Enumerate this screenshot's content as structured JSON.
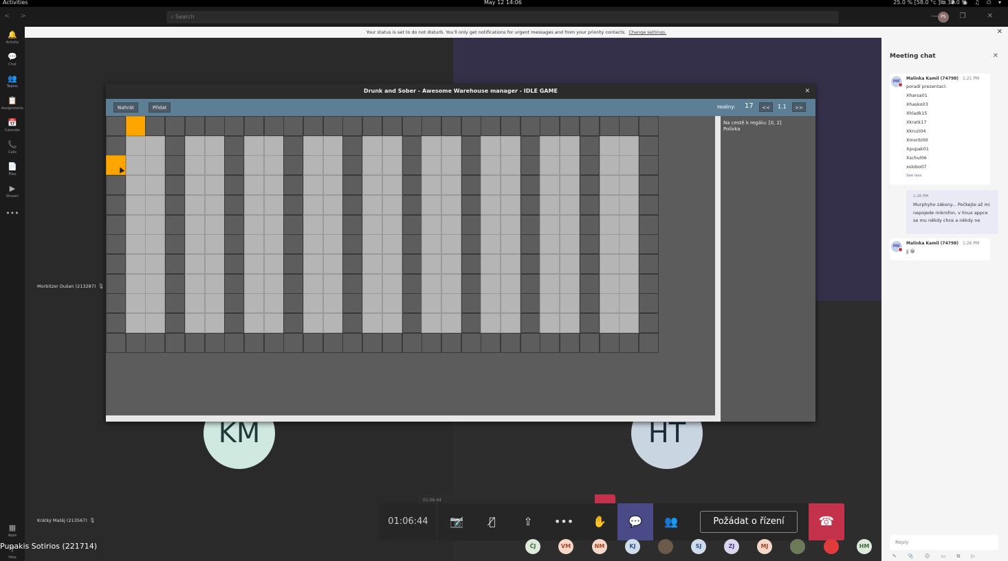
{
  "topbar": {
    "activities": "Activities",
    "clock": "May 12  14:06",
    "stats": "25.0 % [58.0 °c ] ⧉ 32.0 %",
    "sysicons": "⇪ ✱ ◉ ♫ ⏻ ▾"
  },
  "titlebar": {
    "search_placeholder": "Search",
    "me_initials": "PS"
  },
  "rail": [
    {
      "icon": "bell-icon",
      "glyph": "🔔",
      "label": "Activity"
    },
    {
      "icon": "chat-icon",
      "glyph": "💬",
      "label": "Chat"
    },
    {
      "icon": "teams-icon",
      "glyph": "👥",
      "label": "Teams"
    },
    {
      "icon": "assignments-icon",
      "glyph": "📋",
      "label": "Assignments"
    },
    {
      "icon": "calendar-icon",
      "glyph": "📅",
      "label": "Calendar"
    },
    {
      "icon": "calls-icon",
      "glyph": "📞",
      "label": "Calls"
    },
    {
      "icon": "files-icon",
      "glyph": "📄",
      "label": "Files"
    },
    {
      "icon": "stream-icon",
      "glyph": "▶",
      "label": "Stream"
    },
    {
      "icon": "more-icon",
      "glyph": "•••",
      "label": ""
    },
    {
      "icon": "apps-icon",
      "glyph": "▦",
      "label": "Apps"
    },
    {
      "icon": "help-icon",
      "glyph": "?",
      "label": "Help"
    }
  ],
  "banner": {
    "text": "Your status is set to do not disturb. You'll only get notifications for urgent messages and from your priority contacts.",
    "link": "Change settings."
  },
  "participants": {
    "top_left_name": "Morbitzer Dušan (213287)",
    "bottom_left_name": "Krátký Matěj (213567)",
    "km": "KM",
    "ht": "HT",
    "self": "Pupakis Sotirios (221714)"
  },
  "controls": {
    "timer": "01:06:44",
    "ghost_timer": "01:06:44",
    "request_control": "Požádat o řízení"
  },
  "avatars": [
    {
      "initials": "ČJ",
      "bg": "#dfe9dc",
      "fg": "#3c6a3a"
    },
    {
      "initials": "VM",
      "bg": "#f6d7c8",
      "fg": "#a3472a"
    },
    {
      "initials": "NM",
      "bg": "#f6d7c8",
      "fg": "#a3472a"
    },
    {
      "initials": "KJ",
      "bg": "#cfdcec",
      "fg": "#2e5385"
    },
    {
      "initials": "",
      "bg": "#6b5a4a",
      "fg": "#ffffff"
    },
    {
      "initials": "SJ",
      "bg": "#cfdcec",
      "fg": "#2e5385"
    },
    {
      "initials": "ZJ",
      "bg": "#dcd7ef",
      "fg": "#4c3f8c"
    },
    {
      "initials": "MJ",
      "bg": "#f6d7c8",
      "fg": "#a3472a"
    },
    {
      "initials": "",
      "bg": "#6d7a5a",
      "fg": "#ffffff"
    },
    {
      "initials": "",
      "bg": "#e23b3b",
      "fg": "#ffffff"
    },
    {
      "initials": "HM",
      "bg": "#dfe9dc",
      "fg": "#3c6a3a"
    }
  ],
  "chat": {
    "title": "Meeting chat",
    "msg1": {
      "initials": "MK",
      "author": "Malinka Kamil (74798)",
      "time": "1:21 PM",
      "lines": [
        "poradí prezentací:",
        "Xharsa01",
        "Xhasko03",
        "Xhladk15",
        "Xkratk17",
        "Xkruzi04",
        "Xmorbi00",
        "Xpupak01",
        "Xschul06",
        "xslobo07"
      ],
      "see_less": "See less"
    },
    "mine": {
      "time": "1:26 PM",
      "text": "Murphyho zákony... Počkejte až mi nepojede mikrofon, v linux appce se mu někdy chce a někdy ne"
    },
    "msg2": {
      "initials": "MK",
      "author": "Malinka Kamil (74798)",
      "time": "1:26 PM",
      "text": "jj 😀"
    },
    "reply_placeholder": "Reply",
    "reply_tools": "✎ 📎 ☺ ▭ ⧉ ▷ ··· ➤"
  },
  "game": {
    "title": "Drunk and Sober - Awesome Warehouse manager - IDLE GAME",
    "btn_load": "Nahrát",
    "btn_add": "Přidat",
    "hours_label": "Hodiny:",
    "hours_value": "17",
    "prev": "<<",
    "step": "1.1",
    "next": ">>",
    "info_line1": "Na cestě k regálu: [0, 2]",
    "info_line2": "Polívka",
    "grid": {
      "cols": 28,
      "rows": 12,
      "shelf_pairs_start_cols": [
        1,
        4,
        7,
        10,
        13,
        16,
        19,
        22,
        25
      ],
      "shelf_rows": [
        1,
        10
      ],
      "bots": [
        [
          1,
          0
        ],
        [
          0,
          2
        ]
      ]
    }
  }
}
